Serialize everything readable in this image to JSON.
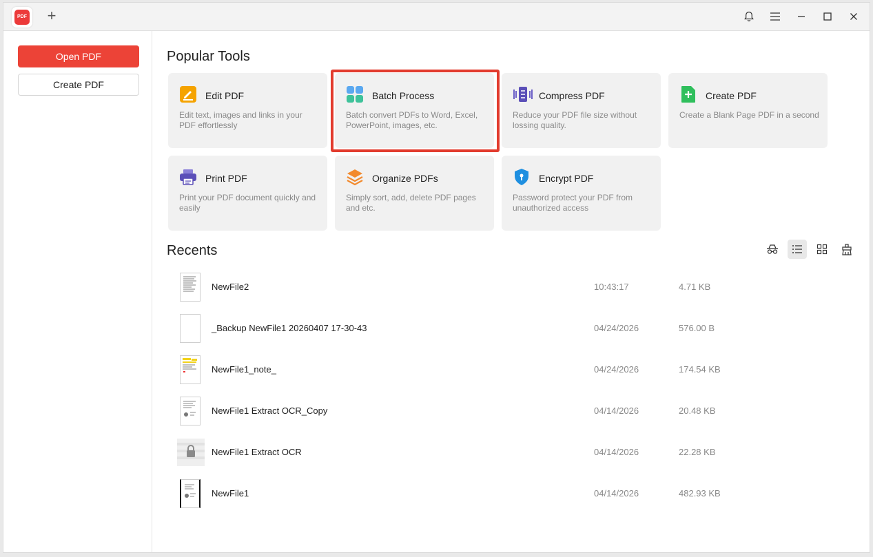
{
  "titlebar": {
    "logo_text": "PDF",
    "new_tab_label": "+",
    "icons": [
      "bell-icon",
      "menu-icon",
      "minimize-icon",
      "maximize-icon",
      "close-icon"
    ]
  },
  "sidebar": {
    "open_label": "Open PDF",
    "create_label": "Create PDF"
  },
  "popular": {
    "title": "Popular Tools",
    "tools": [
      {
        "title": "Edit PDF",
        "desc": "Edit text, images and links in your PDF effortlessly",
        "icon": "edit-pdf-icon"
      },
      {
        "title": "Batch Process",
        "desc": "Batch convert PDFs to Word, Excel, PowerPoint, images, etc.",
        "icon": "batch-process-icon"
      },
      {
        "title": "Compress PDF",
        "desc": "Reduce your PDF file size without lossing quality.",
        "icon": "compress-pdf-icon"
      },
      {
        "title": "Create PDF",
        "desc": "Create a Blank Page PDF in a second",
        "icon": "create-pdf-icon"
      },
      {
        "title": "Print PDF",
        "desc": "Print your PDF document quickly and easily",
        "icon": "print-pdf-icon"
      },
      {
        "title": "Organize PDFs",
        "desc": "Simply sort, add, delete PDF pages and etc.",
        "icon": "organize-pdfs-icon"
      },
      {
        "title": "Encrypt PDF",
        "desc": "Password protect your PDF from unauthorized access",
        "icon": "encrypt-pdf-icon"
      }
    ]
  },
  "recents": {
    "title": "Recents",
    "views": [
      "privacy-view-icon",
      "list-view-icon",
      "grid-view-icon",
      "clear-recents-icon"
    ],
    "files": [
      {
        "name": "NewFile2",
        "date": "10:43:17",
        "size": "4.71 KB"
      },
      {
        "name": "_Backup NewFile1 20260407 17-30-43",
        "date": "04/24/2026",
        "size": "576.00 B"
      },
      {
        "name": "NewFile1_note_",
        "date": "04/24/2026",
        "size": "174.54 KB"
      },
      {
        "name": "NewFile1 Extract OCR_Copy",
        "date": "04/14/2026",
        "size": "20.48 KB"
      },
      {
        "name": "NewFile1 Extract OCR",
        "date": "04/14/2026",
        "size": "22.28 KB"
      },
      {
        "name": "NewFile1",
        "date": "04/14/2026",
        "size": "482.93 KB"
      }
    ]
  },
  "colors": {
    "accent": "#ec4337",
    "highlight": "#e23b2e",
    "card_bg": "#f1f1f1"
  }
}
